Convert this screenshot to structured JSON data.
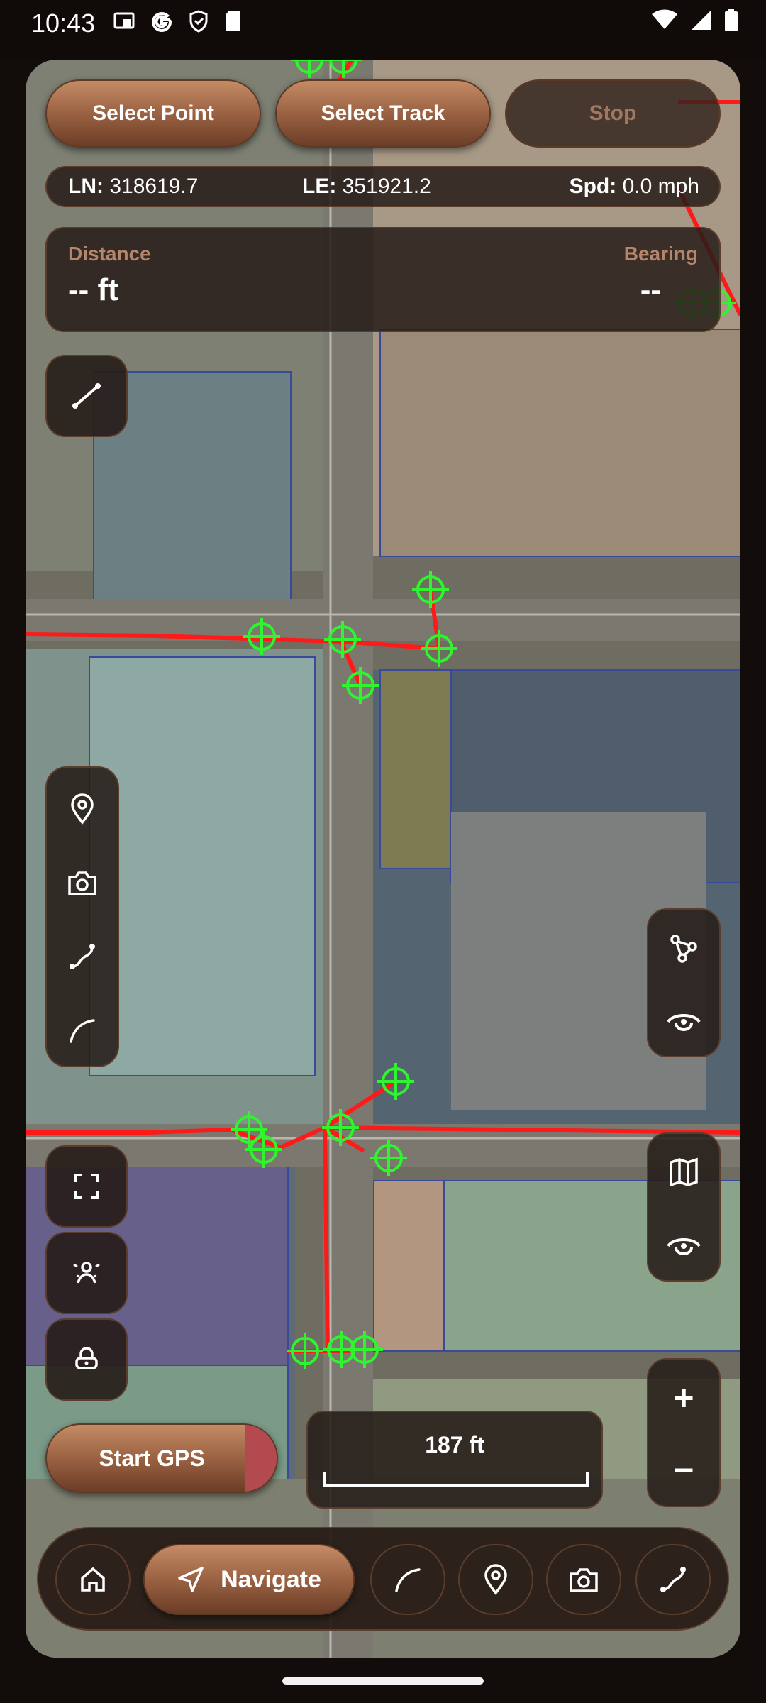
{
  "status_bar": {
    "time": "10:43",
    "left_icons": [
      "cast-icon",
      "google-icon",
      "shield-icon",
      "sd-card-icon"
    ],
    "right_icons": [
      "wifi-icon",
      "signal-icon",
      "battery-icon"
    ]
  },
  "top_actions": {
    "select_point": "Select Point",
    "select_track": "Select Track",
    "stop": "Stop"
  },
  "coords": {
    "ln_label": "LN:",
    "ln_value": "318619.7",
    "le_label": "LE:",
    "le_value": "351921.2",
    "spd_label": "Spd:",
    "spd_value": "0.0 mph"
  },
  "measure": {
    "distance_label": "Distance",
    "distance_value": "-- ft",
    "bearing_label": "Bearing",
    "bearing_value": "--"
  },
  "left_tools": [
    "pin-icon",
    "camera-icon",
    "track-icon",
    "arc-icon"
  ],
  "left_bottom_tools": [
    "fullscreen-icon",
    "person-locate-icon",
    "lock-icon"
  ],
  "right_tools_top": [
    "network-icon",
    "eye-icon"
  ],
  "right_tools_mid": [
    "map-icon",
    "eye-icon"
  ],
  "zoom": {
    "in": "+",
    "out": "−"
  },
  "gps_button": "Start GPS",
  "scale": {
    "label": "187 ft"
  },
  "nav": {
    "navigate_label": "Navigate",
    "icons": [
      "home-icon",
      "navigate-icon",
      "arc-icon",
      "pin-icon",
      "camera-icon",
      "track-icon"
    ]
  },
  "colors": {
    "accent_brown": "#9a6242",
    "track_red": "#ff1a1a",
    "point_green": "#2ef52e",
    "panel_bg": "#261c18"
  }
}
